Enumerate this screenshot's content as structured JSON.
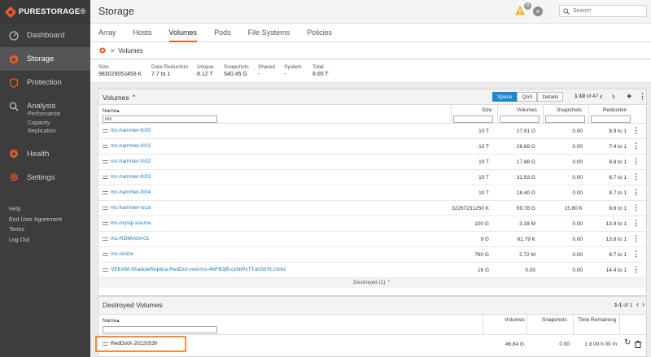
{
  "brand": {
    "name": "PURESTORAGE",
    "suffix": "®"
  },
  "sidebar": {
    "items": [
      {
        "label": "Dashboard",
        "icon": "dashboard-icon"
      },
      {
        "label": "Storage",
        "icon": "storage-icon",
        "active": true
      },
      {
        "label": "Protection",
        "icon": "shield-icon"
      },
      {
        "label": "Analysis",
        "icon": "analysis-icon"
      }
    ],
    "analysis_sub": [
      "Performance",
      "Capacity",
      "Replication"
    ],
    "items2": [
      {
        "label": "Health",
        "icon": "health-icon"
      },
      {
        "label": "Settings",
        "icon": "settings-icon"
      }
    ],
    "links": [
      "Help",
      "End User Agreement",
      "Terms",
      "Log Out"
    ]
  },
  "header": {
    "title": "Storage",
    "alert_count": "8",
    "search_placeholder": "Search"
  },
  "tabs": [
    "Array",
    "Hosts",
    "Volumes",
    "Pods",
    "File Systems",
    "Policies"
  ],
  "breadcrumb": {
    "current": "Volumes"
  },
  "summary": [
    {
      "label": "Size",
      "value": "983029053458 K"
    },
    {
      "label": "Data Reduction",
      "value": "7.7 to 1"
    },
    {
      "label": "Unique",
      "value": "8.12 T"
    },
    {
      "label": "Snapshots",
      "value": "540.45 G"
    },
    {
      "label": "Shared",
      "value": "-"
    },
    {
      "label": "System",
      "value": "-"
    },
    {
      "label": "Total",
      "value": "8.65 T"
    }
  ],
  "volumes_panel": {
    "title": "Volumes",
    "buttons": [
      "Space",
      "QoS",
      "Details"
    ],
    "pager": "1-10",
    "pager_total": "of 47",
    "columns": {
      "name": "Name",
      "size": "Size",
      "volumes": "Volumes",
      "snapshots": "Snapshots",
      "reduction": "Reduction"
    },
    "name_filter": "mc",
    "rows": [
      {
        "name": "mc-hammer-fc00",
        "size": "10 T",
        "volumes": "17.91 G",
        "snapshots": "0.00",
        "reduction": "8.9 to 1"
      },
      {
        "name": "mc-hammer-fc01",
        "size": "10 T",
        "volumes": "26.66 G",
        "snapshots": "0.00",
        "reduction": "7.4 to 1"
      },
      {
        "name": "mc-hammer-fc02",
        "size": "10 T",
        "volumes": "17.88 G",
        "snapshots": "0.00",
        "reduction": "8.8 to 1"
      },
      {
        "name": "mc-hammer-fc03",
        "size": "10 T",
        "volumes": "31.93 G",
        "snapshots": "0.00",
        "reduction": "6.7 to 1"
      },
      {
        "name": "mc-hammer-fc04",
        "size": "10 T",
        "volumes": "18.40 G",
        "snapshots": "0.00",
        "reduction": "8.7 to 1"
      },
      {
        "name": "mc-hammer-iscsi",
        "size": "32267231250 K",
        "volumes": "69.78 G",
        "snapshots": "15.60 K",
        "reduction": "8.6 to 1"
      },
      {
        "name": "mc-mysql-source",
        "size": "100 G",
        "volumes": "3.18 M",
        "snapshots": "0.00",
        "reduction": "13.9 to 1"
      },
      {
        "name": "mc-RDMvVol-01",
        "size": "9 G",
        "volumes": "61.79 K",
        "snapshots": "0.00",
        "reduction": "13.8 to 1"
      },
      {
        "name": "mc-resize",
        "size": "760 G",
        "volumes": "2.72 M",
        "snapshots": "0.00",
        "reduction": "8.7 to 1"
      },
      {
        "name": "VEEAM-ShadowReplica-RedDot-vvol-mc-4hFB3jB-cxNtPxTTuhSbYLzXrkz",
        "size": "16 G",
        "volumes": "0.00",
        "snapshots": "0.00",
        "reduction": "14.4 to 1"
      }
    ],
    "destroyed_toggle": "Destroyed (1)"
  },
  "destroyed_panel": {
    "title": "Destroyed Volumes",
    "pager": "1-1",
    "pager_total": "of 1",
    "columns": {
      "name": "Name",
      "volumes": "Volumes",
      "snapshots": "Snapshots",
      "time": "Time Remaining"
    },
    "rows": [
      {
        "name": "RedDotX-20220530",
        "volumes": "46.84 G",
        "snapshots": "0.00",
        "time": "1 d 00 h 00 m"
      }
    ]
  },
  "colors": {
    "accent": "#f05a28",
    "link": "#1a77c0",
    "button_active": "#1f87d0",
    "sidebar": "#3d3d3d"
  }
}
